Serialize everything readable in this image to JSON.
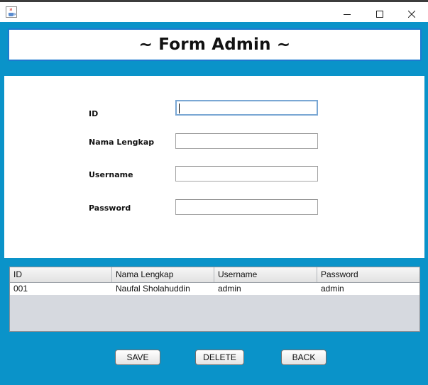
{
  "window": {
    "app_icon": "java-coffee-icon",
    "controls": [
      "minimize-icon",
      "maximize-icon",
      "close-icon"
    ]
  },
  "header": {
    "title": "~ Form Admin ~"
  },
  "form": {
    "id_label": "ID",
    "id_value": "",
    "nama_label": "Nama Lengkap",
    "nama_value": "",
    "username_label": "Username",
    "username_value": "",
    "password_label": "Password",
    "password_value": ""
  },
  "table": {
    "columns": [
      "ID",
      "Nama Lengkap",
      "Username",
      "Password"
    ],
    "rows": [
      [
        "001",
        "Naufal Sholahuddin",
        "admin",
        "admin"
      ]
    ]
  },
  "buttons": {
    "save": "SAVE",
    "delete": "DELETE",
    "back": "BACK"
  },
  "colors": {
    "background": "#0a93c9",
    "title_border": "#1e7ad0",
    "panel": "#ffffff"
  }
}
